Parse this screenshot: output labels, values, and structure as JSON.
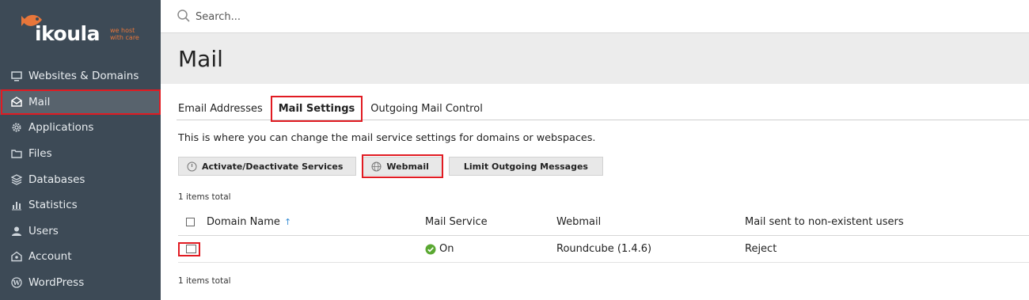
{
  "brand": {
    "name": "ikoula",
    "tagline_1": "we host",
    "tagline_2": "with care"
  },
  "colors": {
    "sidebar_bg": "#3d4a56",
    "accent_red": "#e11b22",
    "brand_orange": "#e8763a",
    "status_green": "#5aa832"
  },
  "search": {
    "placeholder": "Search..."
  },
  "sidebar": {
    "items": [
      {
        "label": "Websites & Domains",
        "icon": "monitor-icon"
      },
      {
        "label": "Mail",
        "icon": "envelope-icon",
        "active": true
      },
      {
        "label": "Applications",
        "icon": "gear-icon"
      },
      {
        "label": "Files",
        "icon": "folder-icon"
      },
      {
        "label": "Databases",
        "icon": "database-icon"
      },
      {
        "label": "Statistics",
        "icon": "bar-chart-icon"
      },
      {
        "label": "Users",
        "icon": "user-icon"
      },
      {
        "label": "Account",
        "icon": "account-icon"
      },
      {
        "label": "WordPress",
        "icon": "wordpress-icon"
      }
    ]
  },
  "page": {
    "title": "Mail"
  },
  "tabs": [
    {
      "label": "Email Addresses"
    },
    {
      "label": "Mail Settings",
      "active": true
    },
    {
      "label": "Outgoing Mail Control"
    }
  ],
  "description": "This is where you can change the mail service settings for domains or webspaces.",
  "toolbar": {
    "activate_label": "Activate/Deactivate Services",
    "webmail_label": "Webmail",
    "limit_label": "Limit Outgoing Messages"
  },
  "table": {
    "count_top": "1 items total",
    "count_bottom": "1 items total",
    "columns": {
      "domain": "Domain Name",
      "sort_indicator": "↑",
      "mail_service": "Mail Service",
      "webmail": "Webmail",
      "nonexistent": "Mail sent to non-existent users"
    },
    "rows": [
      {
        "domain": "",
        "mail_service": "On",
        "webmail": "Roundcube (1.4.6)",
        "nonexistent": "Reject"
      }
    ]
  }
}
